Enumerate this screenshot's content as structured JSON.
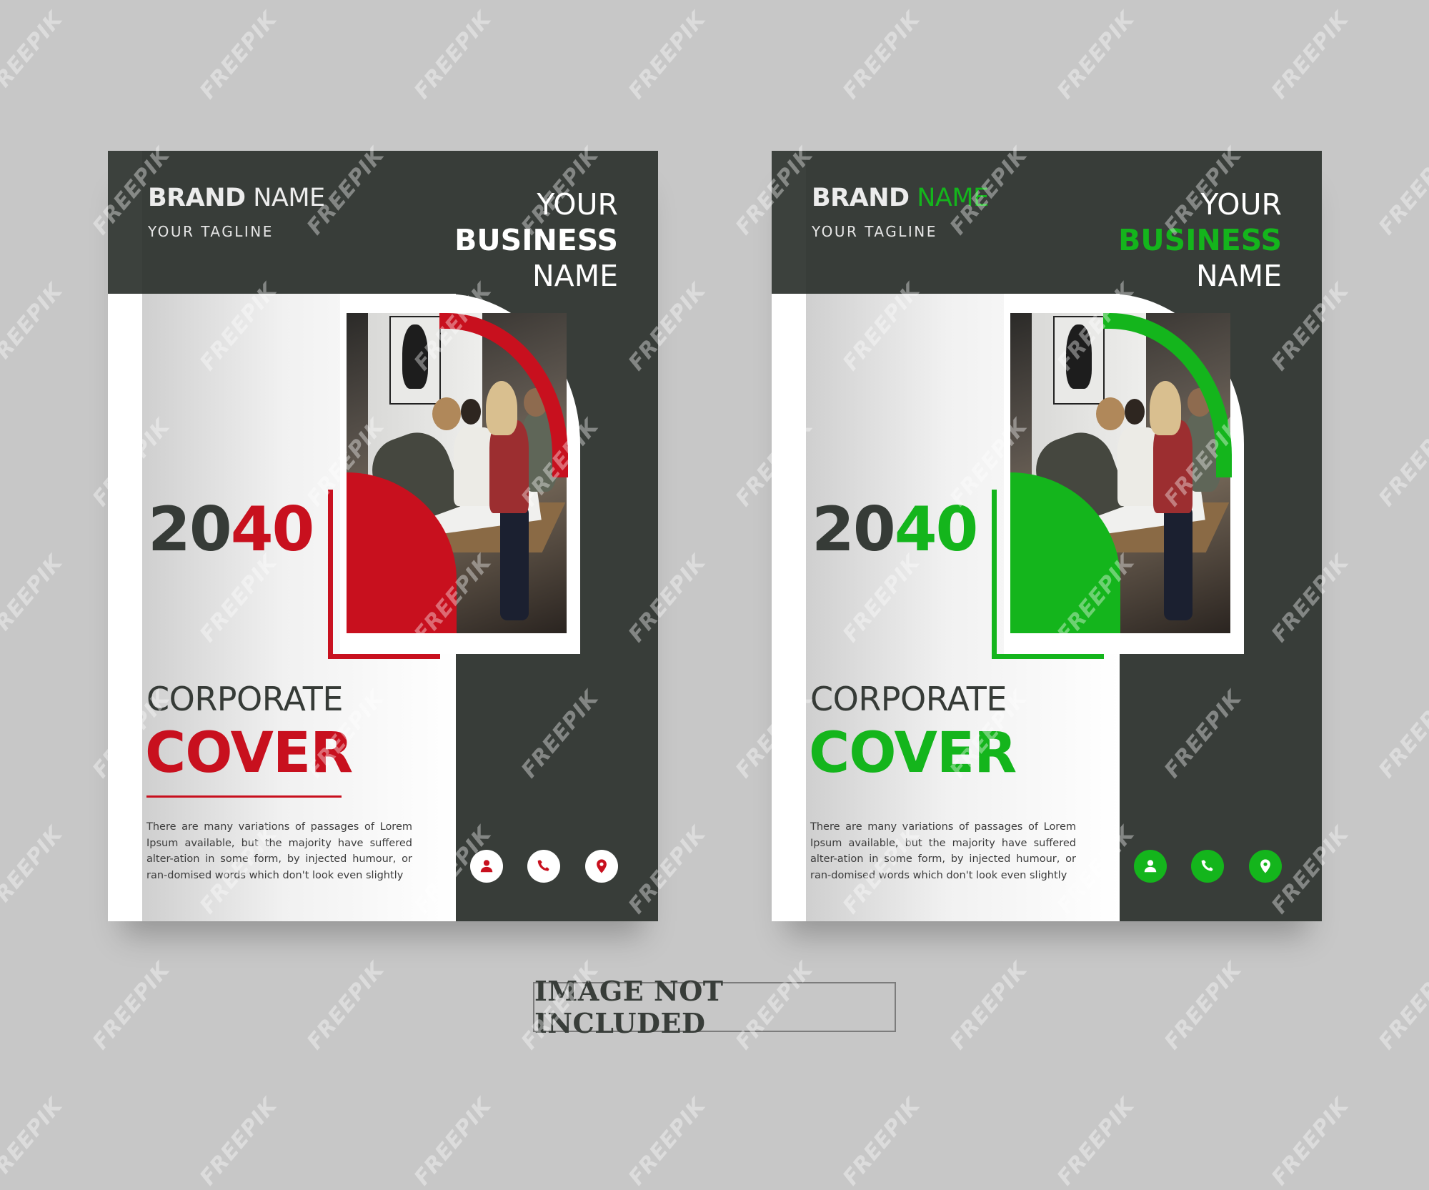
{
  "colors": {
    "background": "#c7c7c7",
    "dark": "#383d39",
    "red_accent": "#c8101e",
    "green_accent": "#14b51c",
    "white": "#ffffff"
  },
  "covers": [
    {
      "variant": "red",
      "accent": "#c8101e",
      "brand_bold": "BRAND",
      "brand_light": "NAME",
      "tagline": "YOUR TAGLINE",
      "business_line1": "YOUR",
      "business_line2": "BUSINESS",
      "business_line3": "NAME",
      "year_part1": "20",
      "year_part2": "40",
      "heading_line1": "CORPORATE",
      "heading_line2": "COVER",
      "has_underline": true,
      "body": "There are many variations of passages of Lorem Ipsum available, but the majority have suffered alter-ation in some form, by injected humour, or ran-domised words which don't look even slightly",
      "contact_icons": [
        "user-icon",
        "phone-icon",
        "location-pin-icon"
      ]
    },
    {
      "variant": "green",
      "accent": "#14b51c",
      "brand_bold": "BRAND",
      "brand_light": "NAME",
      "tagline": "YOUR TAGLINE",
      "business_line1": "YOUR",
      "business_line2": "BUSINESS",
      "business_line3": "NAME",
      "year_part1": "20",
      "year_part2": "40",
      "heading_line1": "CORPORATE",
      "heading_line2": "COVER",
      "has_underline": false,
      "body": "There are many variations of passages of Lorem Ipsum available, but the majority have suffered alter-ation in some form, by injected humour, or ran-domised words which don't look even slightly",
      "contact_icons": [
        "user-icon",
        "phone-icon",
        "location-pin-icon"
      ]
    }
  ],
  "notice": "IMAGE NOT INCLUDED",
  "watermark": "FREEPIK"
}
